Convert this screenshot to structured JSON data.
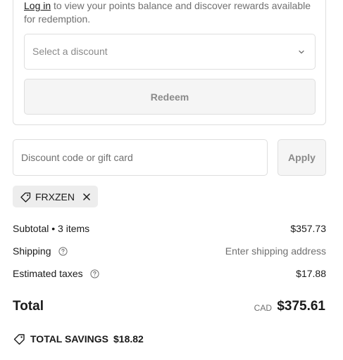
{
  "rewards": {
    "login_link": "Log in",
    "login_text": " to view your points balance and discover rewards available for redemption.",
    "select_placeholder": "Select a discount",
    "redeem_label": "Redeem"
  },
  "discount": {
    "input_placeholder": "Discount code or gift card",
    "apply_label": "Apply",
    "applied_code": "FRXZEN"
  },
  "summary": {
    "subtotal_label": "Subtotal • 3 items",
    "subtotal_value": "$357.73",
    "shipping_label": "Shipping",
    "shipping_value": "Enter shipping address",
    "taxes_label": "Estimated taxes",
    "taxes_value": "$17.88",
    "total_label": "Total",
    "total_currency": "CAD",
    "total_value": "$375.61",
    "savings_label": "TOTAL SAVINGS",
    "savings_value": "$18.82"
  },
  "icons": {
    "chevron": "chevron-down-icon",
    "tag": "tag-icon",
    "close": "close-icon",
    "help": "question-circle-icon",
    "savings": "tag-icon"
  },
  "colors": {
    "text": "#1a1a1a",
    "muted": "#707070",
    "border": "#dedede",
    "chip_bg": "#ededed",
    "button_bg": "#f5f5f5"
  }
}
